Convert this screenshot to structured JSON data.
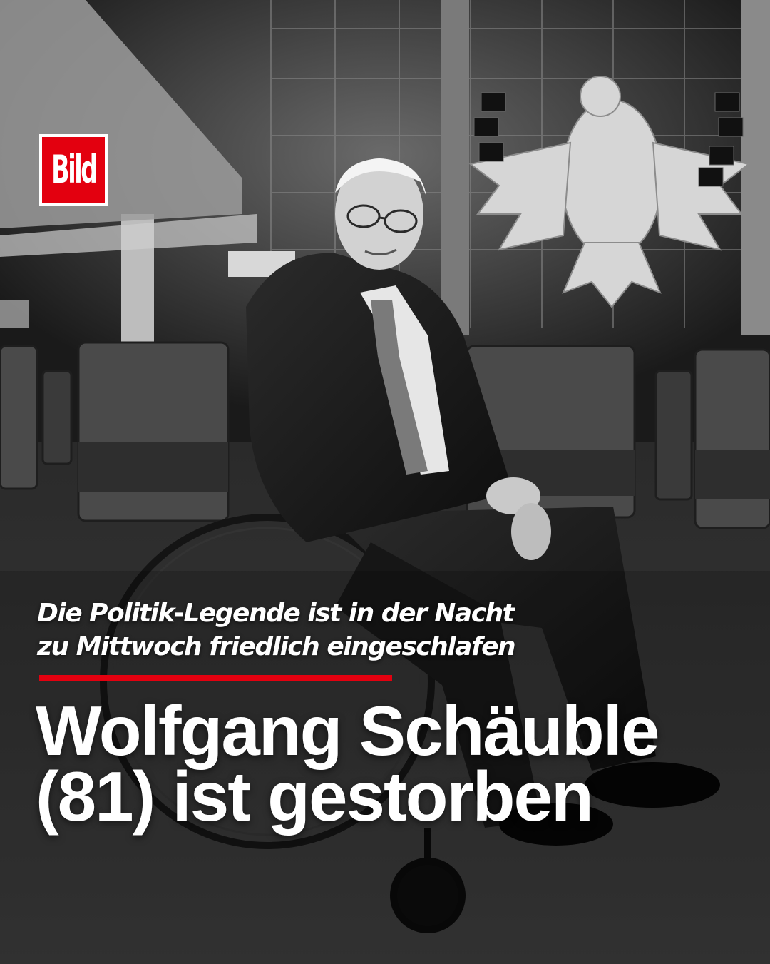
{
  "logo": {
    "text": "BILD",
    "brand_color": "#e3000f"
  },
  "headline": {
    "kicker_lines": [
      "Die Politik-Legende ist in der Nacht",
      "zu Mittwoch friedlich eingeschlafen"
    ],
    "title_lines": [
      "Wolfgang Schäuble",
      "(81) ist gestorben"
    ],
    "accent_color": "#e3000f"
  },
  "photo": {
    "style": "black-and-white"
  }
}
